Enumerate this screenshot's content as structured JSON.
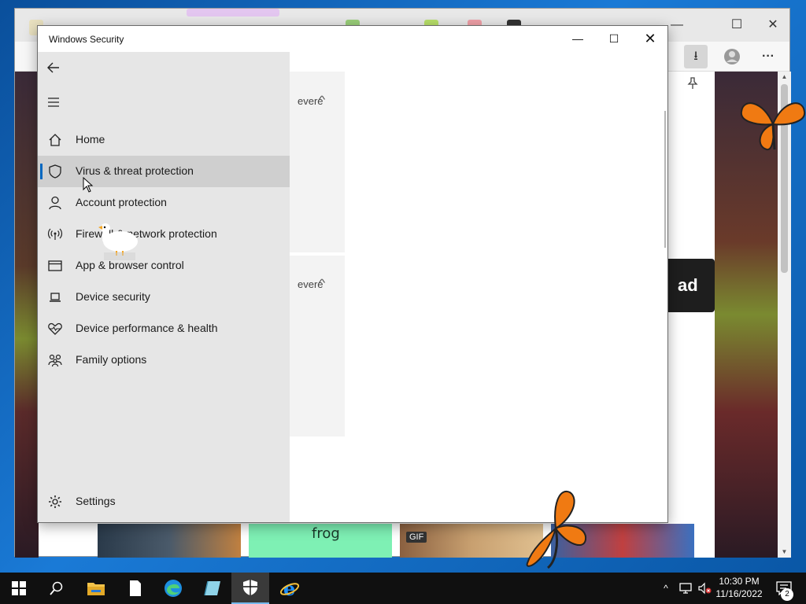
{
  "window": {
    "title": "Windows Security",
    "minimize_glyph": "—",
    "maximize_glyph": "☐",
    "close_glyph": "✕"
  },
  "nav": {
    "back_icon": "back-arrow-icon",
    "menu_icon": "hamburger-menu-icon",
    "items": [
      {
        "label": "Home",
        "icon": "home-icon",
        "selected": false
      },
      {
        "label": "Virus & threat protection",
        "icon": "shield-icon",
        "selected": true
      },
      {
        "label": "Account protection",
        "icon": "person-icon",
        "selected": false
      },
      {
        "label": "Firewall & network protection",
        "icon": "antenna-icon",
        "selected": false
      },
      {
        "label": "App & browser control",
        "icon": "browser-window-icon",
        "selected": false
      },
      {
        "label": "Device security",
        "icon": "laptop-icon",
        "selected": false
      },
      {
        "label": "Device performance & health",
        "icon": "heart-pulse-icon",
        "selected": false
      },
      {
        "label": "Family options",
        "icon": "family-icon",
        "selected": false
      }
    ],
    "settings": {
      "label": "Settings",
      "icon": "gear-icon"
    }
  },
  "content": {
    "card1_label": "evere",
    "card2_label": "evere"
  },
  "browser": {
    "download_button_text": "ad",
    "gif_badge": "GIF",
    "frog_text": "frog"
  },
  "taskbar": {
    "clock_time": "10:30 PM",
    "clock_date": "11/16/2022",
    "notification_count": "2",
    "items": [
      "start-icon",
      "search-icon",
      "file-explorer-icon",
      "notepad-icon",
      "edge-icon",
      "app-icon",
      "windows-security-icon",
      "internet-explorer-icon"
    ]
  },
  "colors": {
    "accent": "#0067c0",
    "nav_bg": "#e6e6e6",
    "nav_selected": "#cfcfcf",
    "taskbar_bg": "#101010"
  }
}
